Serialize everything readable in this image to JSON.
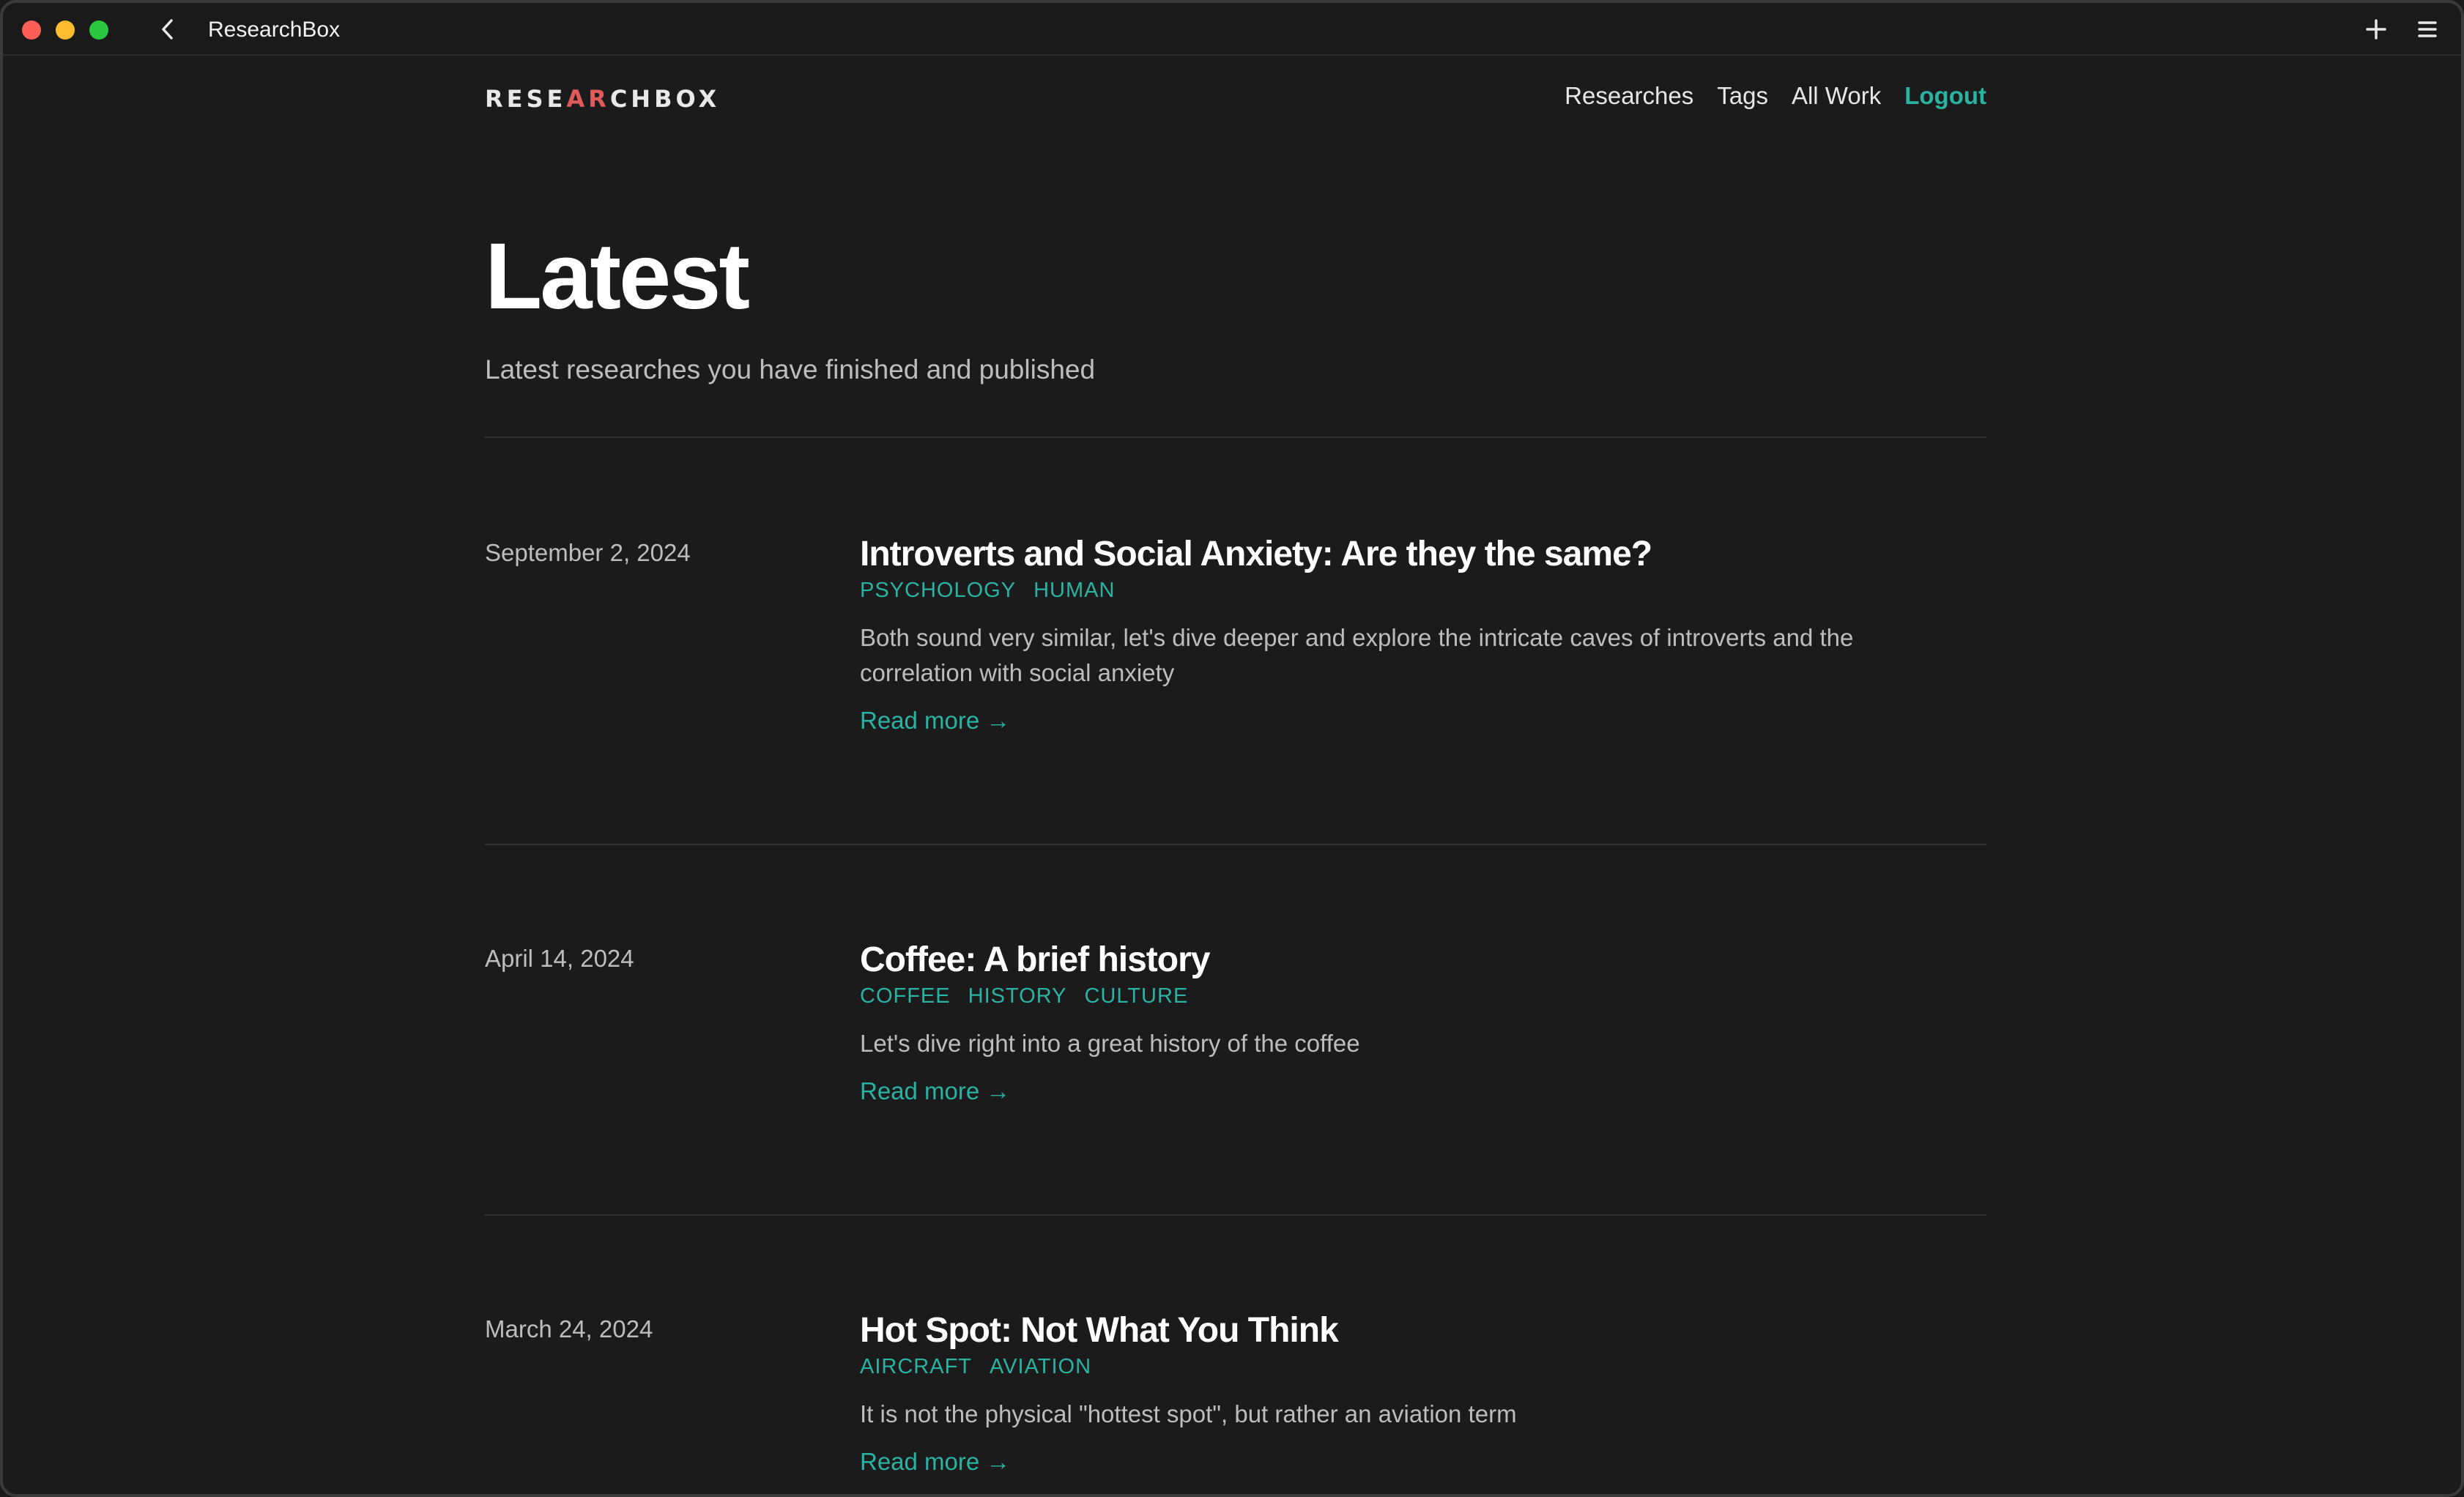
{
  "window": {
    "title": "ResearchBox"
  },
  "header": {
    "logo_prefix": "RESE",
    "logo_accent": "A",
    "logo_mid": "R",
    "logo_suffix": "CHBOX",
    "nav": [
      "Researches",
      "Tags",
      "All Work"
    ],
    "logout_label": "Logout"
  },
  "main": {
    "title": "Latest",
    "subtitle": "Latest researches you have finished and published",
    "articles": [
      {
        "date": "September 2, 2024",
        "title": "Introverts and Social Anxiety: Are they the same?",
        "tags": [
          "PSYCHOLOGY",
          "HUMAN"
        ],
        "excerpt": "Both sound very similar, let's dive deeper and explore the intricate caves of introverts and the correlation with social anxiety",
        "read_more": "Read more →"
      },
      {
        "date": "April 14, 2024",
        "title": "Coffee: A brief history",
        "tags": [
          "COFFEE",
          "HISTORY",
          "CULTURE"
        ],
        "excerpt": "Let's dive right into a great history of the coffee",
        "read_more": "Read more →"
      },
      {
        "date": "March 24, 2024",
        "title": "Hot Spot: Not What You Think",
        "tags": [
          "AIRCRAFT",
          "AVIATION"
        ],
        "excerpt": "It is not the physical \"hottest spot\", but rather an aviation term",
        "read_more": "Read more →"
      }
    ]
  },
  "colors": {
    "background": "#1b1b1b",
    "accent": "#2ab3a3",
    "logo_accent": "#e05a5a"
  }
}
